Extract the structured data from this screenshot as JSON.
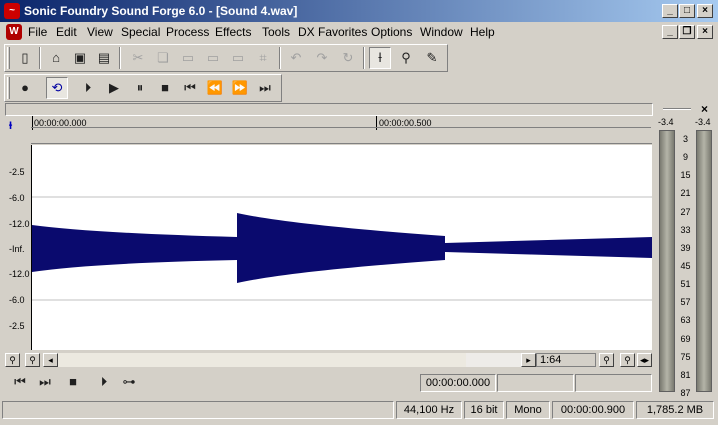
{
  "window": {
    "title": "Sonic Foundry Sound Forge 6.0 - [Sound 4.wav]"
  },
  "menu": [
    "File",
    "Edit",
    "View",
    "Special",
    "Process",
    "Effects",
    "Tools",
    "DX Favorites",
    "Options",
    "Window",
    "Help"
  ],
  "ruler": {
    "start": "00:00:00.000",
    "mid": "00:00:00.500"
  },
  "db_scale": [
    "-2.5",
    "-6.0",
    "-12.0",
    "-Inf.",
    "-12.0",
    "-6.0",
    "-2.5"
  ],
  "scroll": {
    "zoom_ratio": "1:64"
  },
  "transport": {
    "position": "00:00:00.000"
  },
  "status": {
    "sample_rate": "44,100 Hz",
    "bit_depth": "16 bit",
    "channels": "Mono",
    "length": "00:00:00.900",
    "disk_space": "1,785.2 MB"
  },
  "meter": {
    "peak_left": "-3.4",
    "peak_right": "-3.4",
    "ticks": [
      "3",
      "9",
      "15",
      "21",
      "27",
      "33",
      "39",
      "45",
      "51",
      "57",
      "63",
      "69",
      "75",
      "81",
      "87"
    ]
  },
  "colors": {
    "waveform": "#0a0a6e",
    "title_start": "#0a246a",
    "title_end": "#a6caf0"
  }
}
